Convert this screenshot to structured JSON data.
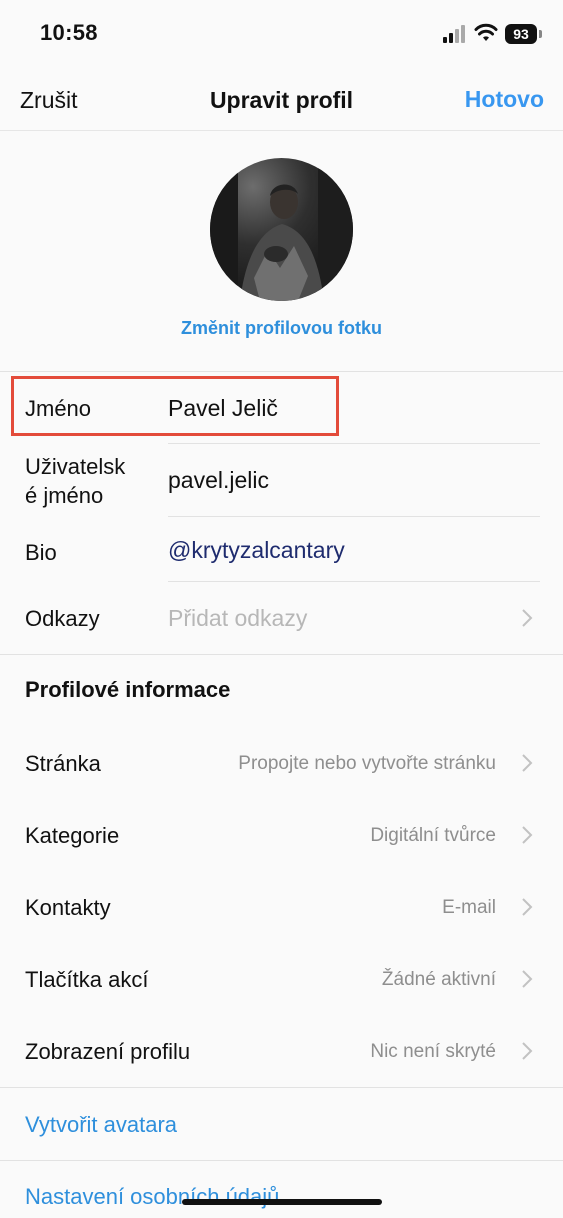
{
  "status_bar": {
    "time": "10:58",
    "battery": "93"
  },
  "nav": {
    "cancel": "Zrušit",
    "title": "Upravit profil",
    "done": "Hotovo"
  },
  "profile": {
    "change_photo": "Změnit profilovou fotku"
  },
  "fields": {
    "name": {
      "label": "Jméno",
      "value": "Pavel Jelič"
    },
    "username": {
      "label_line1": "Uživatelsk",
      "label_line2": "é jméno",
      "value": "pavel.jelic"
    },
    "bio": {
      "label": "Bio",
      "value": "@krytyzalcantary"
    },
    "links": {
      "label": "Odkazy",
      "placeholder": "Přidat odkazy"
    }
  },
  "profile_info": {
    "title": "Profilové informace",
    "rows": [
      {
        "label": "Stránka",
        "value": "Propojte nebo vytvořte stránku"
      },
      {
        "label": "Kategorie",
        "value": "Digitální tvůrce"
      },
      {
        "label": "Kontakty",
        "value": "E-mail"
      },
      {
        "label": "Tlačítka akcí",
        "value": "Žádné aktivní"
      },
      {
        "label": "Zobrazení profilu",
        "value": "Nic není skryté"
      }
    ]
  },
  "actions": {
    "create_avatar": "Vytvořit avatara",
    "personal_info": "Nastavení osobních údajů"
  },
  "colors": {
    "accent": "#3897f0",
    "link": "#2e8fdc",
    "highlight": "#e34b3a"
  }
}
